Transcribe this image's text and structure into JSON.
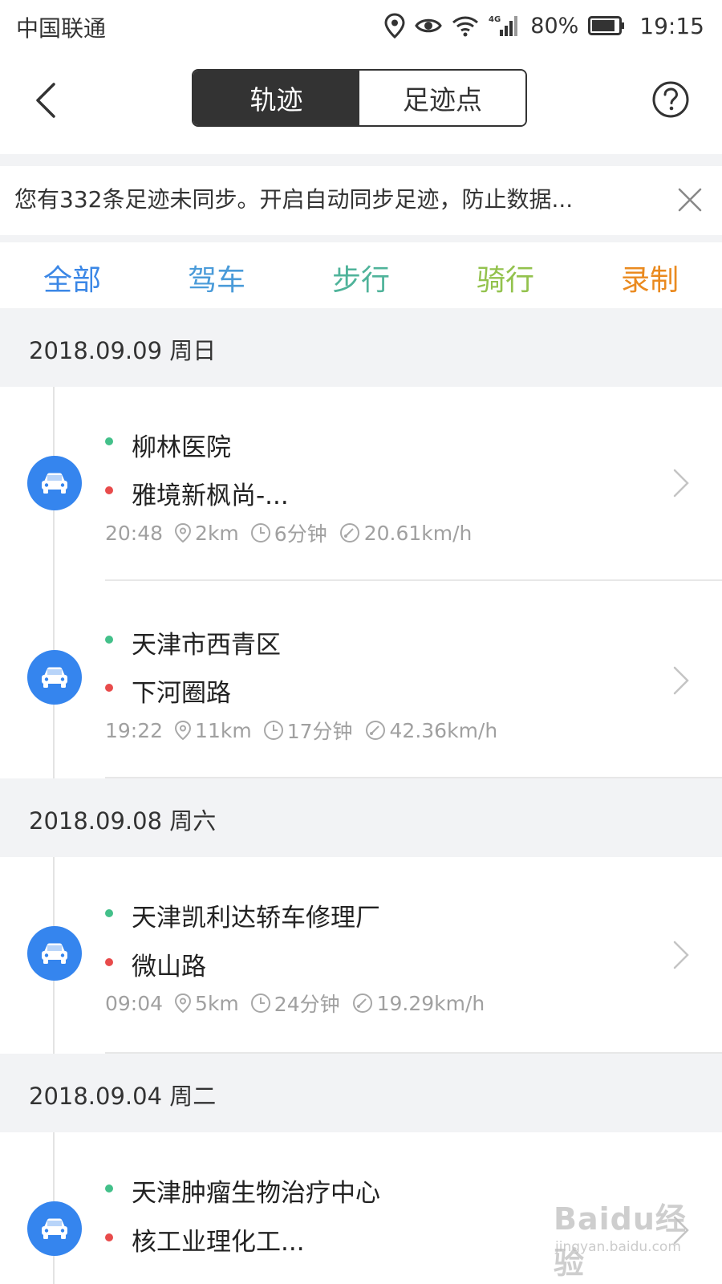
{
  "status_bar": {
    "carrier": "中国联通",
    "network_type": "4G",
    "battery": "80%",
    "time": "19:15"
  },
  "header": {
    "segments": [
      "轨迹",
      "足迹点"
    ]
  },
  "notice": {
    "text": "您有332条足迹未同步。开启自动同步足迹，防止数据..."
  },
  "tabs": [
    {
      "label": "全部",
      "color": "#3b87e6",
      "style": "color:#3b87e6"
    },
    {
      "label": "驾车",
      "color": "#4a9bd9",
      "style": "color:#4a9bd9"
    },
    {
      "label": "步行",
      "color": "#4fb39a",
      "style": "color:#4fb39a"
    },
    {
      "label": "骑行",
      "color": "#93c24d",
      "style": "color:#93c24d"
    },
    {
      "label": "录制",
      "color": "#ea8a1f",
      "style": "color:#ea8a1f"
    }
  ],
  "groups": [
    {
      "date": "2018.09.09 周日",
      "trips": [
        {
          "mode_icon": "car-icon",
          "start": "柳林医院",
          "end": "雅境新枫尚-...",
          "time": "20:48",
          "distance": "2km",
          "duration": "6分钟",
          "speed": "20.61km/h"
        },
        {
          "mode_icon": "car-icon",
          "start": "天津市西青区",
          "end": "下河圈路",
          "time": "19:22",
          "distance": "11km",
          "duration": "17分钟",
          "speed": "42.36km/h"
        }
      ]
    },
    {
      "date": "2018.09.08 周六",
      "trips": [
        {
          "mode_icon": "car-icon",
          "start": "天津凯利达轿车修理厂",
          "end": "微山路",
          "time": "09:04",
          "distance": "5km",
          "duration": "24分钟",
          "speed": "19.29km/h"
        }
      ]
    },
    {
      "date": "2018.09.04 周二",
      "trips": [
        {
          "mode_icon": "car-icon",
          "start": "天津肿瘤生物治疗中心",
          "end": "核工业理化工..."
        }
      ]
    }
  ],
  "watermark": {
    "logo": "Baidu经验",
    "url": "jingyan.baidu.com"
  },
  "colors": {
    "accent": "#3b87e6",
    "car_badge": "#3585ee",
    "start_dot": "#43c08a",
    "end_dot": "#e84b4b",
    "segment_active_bg": "#333333",
    "list_header_bg": "#f2f3f5"
  }
}
